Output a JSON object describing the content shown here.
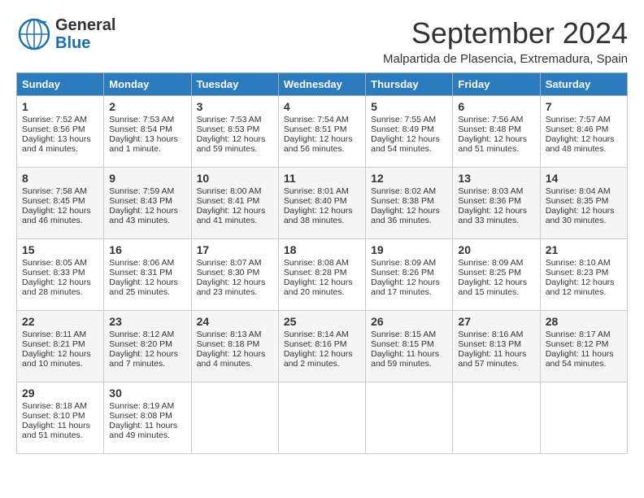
{
  "header": {
    "logo_line1": "General",
    "logo_line2": "Blue",
    "month_title": "September 2024",
    "subtitle": "Malpartida de Plasencia, Extremadura, Spain"
  },
  "weekdays": [
    "Sunday",
    "Monday",
    "Tuesday",
    "Wednesday",
    "Thursday",
    "Friday",
    "Saturday"
  ],
  "weeks": [
    [
      {
        "day": "1",
        "sunrise": "7:52 AM",
        "sunset": "8:56 PM",
        "daylight": "13 hours and 4 minutes."
      },
      {
        "day": "2",
        "sunrise": "7:53 AM",
        "sunset": "8:54 PM",
        "daylight": "13 hours and 1 minute."
      },
      {
        "day": "3",
        "sunrise": "7:53 AM",
        "sunset": "8:53 PM",
        "daylight": "12 hours and 59 minutes."
      },
      {
        "day": "4",
        "sunrise": "7:54 AM",
        "sunset": "8:51 PM",
        "daylight": "12 hours and 56 minutes."
      },
      {
        "day": "5",
        "sunrise": "7:55 AM",
        "sunset": "8:49 PM",
        "daylight": "12 hours and 54 minutes."
      },
      {
        "day": "6",
        "sunrise": "7:56 AM",
        "sunset": "8:48 PM",
        "daylight": "12 hours and 51 minutes."
      },
      {
        "day": "7",
        "sunrise": "7:57 AM",
        "sunset": "8:46 PM",
        "daylight": "12 hours and 48 minutes."
      }
    ],
    [
      {
        "day": "8",
        "sunrise": "7:58 AM",
        "sunset": "8:45 PM",
        "daylight": "12 hours and 46 minutes."
      },
      {
        "day": "9",
        "sunrise": "7:59 AM",
        "sunset": "8:43 PM",
        "daylight": "12 hours and 43 minutes."
      },
      {
        "day": "10",
        "sunrise": "8:00 AM",
        "sunset": "8:41 PM",
        "daylight": "12 hours and 41 minutes."
      },
      {
        "day": "11",
        "sunrise": "8:01 AM",
        "sunset": "8:40 PM",
        "daylight": "12 hours and 38 minutes."
      },
      {
        "day": "12",
        "sunrise": "8:02 AM",
        "sunset": "8:38 PM",
        "daylight": "12 hours and 36 minutes."
      },
      {
        "day": "13",
        "sunrise": "8:03 AM",
        "sunset": "8:36 PM",
        "daylight": "12 hours and 33 minutes."
      },
      {
        "day": "14",
        "sunrise": "8:04 AM",
        "sunset": "8:35 PM",
        "daylight": "12 hours and 30 minutes."
      }
    ],
    [
      {
        "day": "15",
        "sunrise": "8:05 AM",
        "sunset": "8:33 PM",
        "daylight": "12 hours and 28 minutes."
      },
      {
        "day": "16",
        "sunrise": "8:06 AM",
        "sunset": "8:31 PM",
        "daylight": "12 hours and 25 minutes."
      },
      {
        "day": "17",
        "sunrise": "8:07 AM",
        "sunset": "8:30 PM",
        "daylight": "12 hours and 23 minutes."
      },
      {
        "day": "18",
        "sunrise": "8:08 AM",
        "sunset": "8:28 PM",
        "daylight": "12 hours and 20 minutes."
      },
      {
        "day": "19",
        "sunrise": "8:09 AM",
        "sunset": "8:26 PM",
        "daylight": "12 hours and 17 minutes."
      },
      {
        "day": "20",
        "sunrise": "8:09 AM",
        "sunset": "8:25 PM",
        "daylight": "12 hours and 15 minutes."
      },
      {
        "day": "21",
        "sunrise": "8:10 AM",
        "sunset": "8:23 PM",
        "daylight": "12 hours and 12 minutes."
      }
    ],
    [
      {
        "day": "22",
        "sunrise": "8:11 AM",
        "sunset": "8:21 PM",
        "daylight": "12 hours and 10 minutes."
      },
      {
        "day": "23",
        "sunrise": "8:12 AM",
        "sunset": "8:20 PM",
        "daylight": "12 hours and 7 minutes."
      },
      {
        "day": "24",
        "sunrise": "8:13 AM",
        "sunset": "8:18 PM",
        "daylight": "12 hours and 4 minutes."
      },
      {
        "day": "25",
        "sunrise": "8:14 AM",
        "sunset": "8:16 PM",
        "daylight": "12 hours and 2 minutes."
      },
      {
        "day": "26",
        "sunrise": "8:15 AM",
        "sunset": "8:15 PM",
        "daylight": "11 hours and 59 minutes."
      },
      {
        "day": "27",
        "sunrise": "8:16 AM",
        "sunset": "8:13 PM",
        "daylight": "11 hours and 57 minutes."
      },
      {
        "day": "28",
        "sunrise": "8:17 AM",
        "sunset": "8:12 PM",
        "daylight": "11 hours and 54 minutes."
      }
    ],
    [
      {
        "day": "29",
        "sunrise": "8:18 AM",
        "sunset": "8:10 PM",
        "daylight": "11 hours and 51 minutes."
      },
      {
        "day": "30",
        "sunrise": "8:19 AM",
        "sunset": "8:08 PM",
        "daylight": "11 hours and 49 minutes."
      },
      null,
      null,
      null,
      null,
      null
    ]
  ]
}
